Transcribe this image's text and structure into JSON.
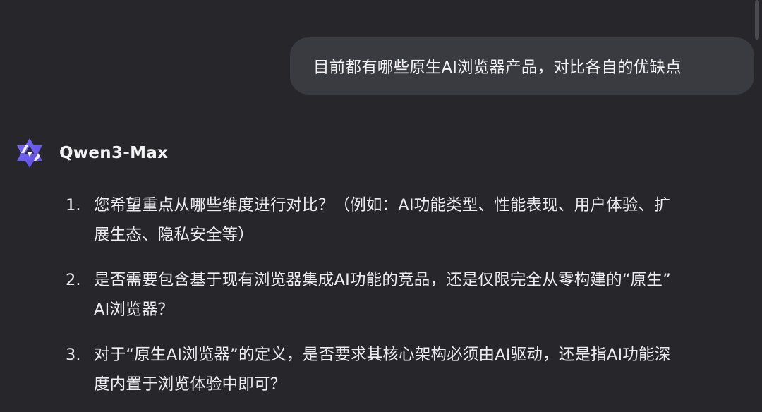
{
  "user_message": "目前都有哪些原生AI浏览器产品，对比各自的优缺点",
  "assistant": {
    "model_name": "Qwen3-Max",
    "logo_icon": "qwen-logo-icon",
    "accent_color": "#6b5cf0",
    "items": [
      {
        "number": "1.",
        "lines": [
          "您希望重点从哪些维度进行对比？（例如：AI功能类型、性能表现、用户体验、扩",
          "展生态、隐私安全等）"
        ]
      },
      {
        "number": "2.",
        "lines": [
          "是否需要包含基于现有浏览器集成AI功能的竞品，还是仅限完全从零构建的“原生”",
          "AI浏览器？"
        ]
      },
      {
        "number": "3.",
        "lines": [
          "对于“原生AI浏览器”的定义，是否要求其核心架构必须由AI驱动，还是指AI功能深",
          "度内置于浏览体验中即可？"
        ]
      }
    ]
  }
}
